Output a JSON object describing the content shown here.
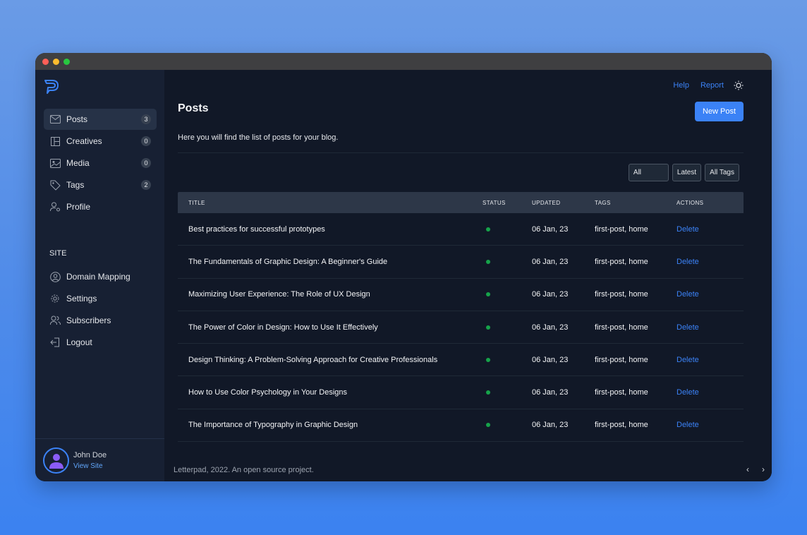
{
  "app": {
    "brand_color": "#3b82f6"
  },
  "sidebar": {
    "items": [
      {
        "label": "Posts",
        "count": "3",
        "icon": "mail-icon"
      },
      {
        "label": "Creatives",
        "count": "0",
        "icon": "layout-icon"
      },
      {
        "label": "Media",
        "count": "0",
        "icon": "image-icon"
      },
      {
        "label": "Tags",
        "count": "2",
        "icon": "tag-icon"
      },
      {
        "label": "Profile",
        "icon": "user-gear-icon"
      }
    ],
    "section_label": "SITE",
    "site_items": [
      {
        "label": "Domain Mapping",
        "icon": "user-circle-icon"
      },
      {
        "label": "Settings",
        "icon": "gear-icon"
      },
      {
        "label": "Subscribers",
        "icon": "users-icon"
      },
      {
        "label": "Logout",
        "icon": "logout-icon"
      }
    ],
    "user": {
      "name": "John Doe",
      "view_site": "View Site"
    }
  },
  "header": {
    "help": "Help",
    "report": "Report",
    "theme_icon": "sun-icon"
  },
  "main": {
    "title": "Posts",
    "new_post": "New Post",
    "description": "Here you will find the list of posts for your blog.",
    "filters": {
      "status": "All",
      "sort": "Latest",
      "tags": "All Tags"
    },
    "table": {
      "headers": {
        "title": "TITLE",
        "status": "STATUS",
        "updated": "UPDATED",
        "tags": "TAGS",
        "actions": "ACTIONS"
      },
      "rows": [
        {
          "title": "Best practices for successful prototypes",
          "status": "published",
          "updated": "06 Jan, 23",
          "tags": "first-post, home",
          "action": "Delete"
        },
        {
          "title": "The Fundamentals of Graphic Design: A Beginner's Guide",
          "status": "published",
          "updated": "06 Jan, 23",
          "tags": "first-post, home",
          "action": "Delete"
        },
        {
          "title": "Maximizing User Experience: The Role of UX Design",
          "status": "published",
          "updated": "06 Jan, 23",
          "tags": "first-post, home",
          "action": "Delete"
        },
        {
          "title": "The Power of Color in Design: How to Use It Effectively",
          "status": "published",
          "updated": "06 Jan, 23",
          "tags": "first-post, home",
          "action": "Delete"
        },
        {
          "title": "Design Thinking: A Problem-Solving Approach for Creative Professionals",
          "status": "published",
          "updated": "06 Jan, 23",
          "tags": "first-post, home",
          "action": "Delete"
        },
        {
          "title": "How to Use Color Psychology in Your Designs",
          "status": "published",
          "updated": "06 Jan, 23",
          "tags": "first-post, home",
          "action": "Delete"
        },
        {
          "title": "The Importance of Typography in Graphic Design",
          "status": "published",
          "updated": "06 Jan, 23",
          "tags": "first-post, home",
          "action": "Delete"
        }
      ]
    }
  },
  "footer": {
    "text": "Letterpad, 2022. An open source project.",
    "prev": "‹",
    "next": "›"
  }
}
